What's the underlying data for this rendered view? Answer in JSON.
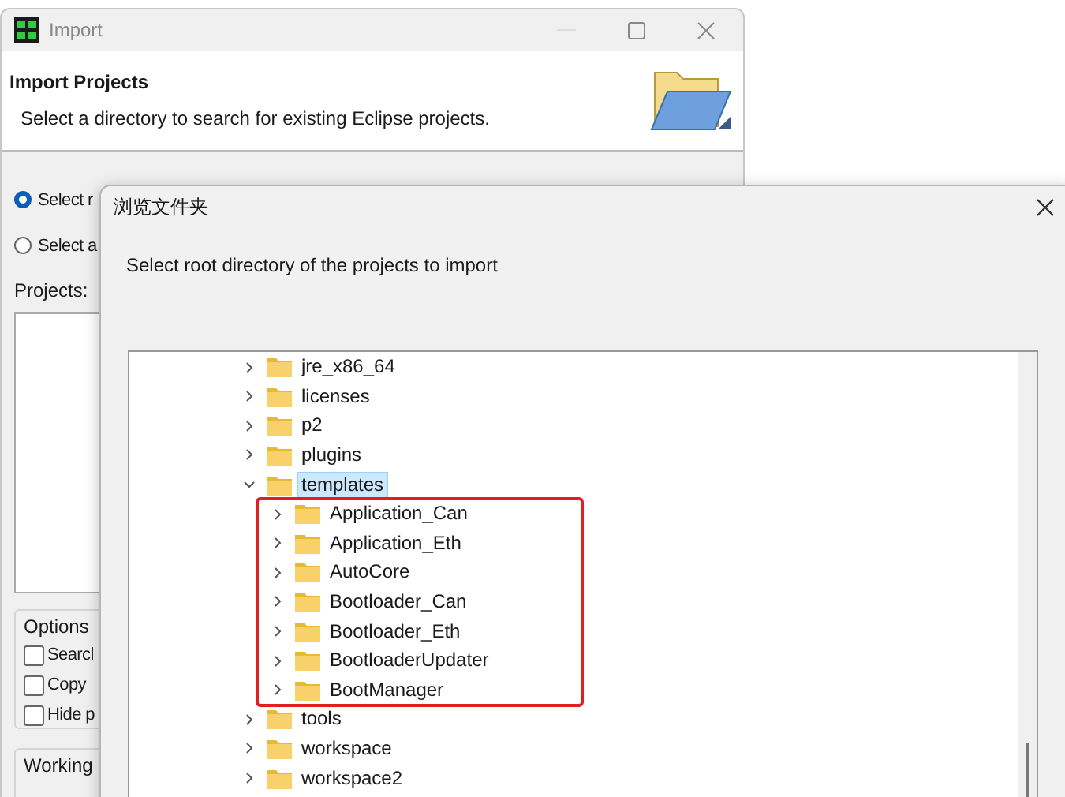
{
  "import_window": {
    "title": "Import",
    "header": {
      "title": "Import Projects",
      "description": "Select a directory to search for existing Eclipse projects."
    },
    "source_options": [
      {
        "label": "Select r",
        "selected": true
      },
      {
        "label": "Select a",
        "selected": false
      }
    ],
    "projects_label": "Projects:",
    "options_group": {
      "title": "Options",
      "checkboxes": [
        {
          "label": "Searcl",
          "checked": false
        },
        {
          "label": "Copy",
          "checked": false
        },
        {
          "label": "Hide p",
          "checked": false
        }
      ]
    },
    "working_group": {
      "title": "Working"
    }
  },
  "browse_dialog": {
    "title": "浏览文件夹",
    "prompt": "Select root directory of the projects to import",
    "tree": [
      {
        "name": "jre_x86_64",
        "expanded": false,
        "selected": false
      },
      {
        "name": "licenses",
        "expanded": false,
        "selected": false
      },
      {
        "name": "p2",
        "expanded": false,
        "selected": false
      },
      {
        "name": "plugins",
        "expanded": false,
        "selected": false
      },
      {
        "name": "templates",
        "expanded": true,
        "selected": true,
        "children": [
          {
            "name": "Application_Can",
            "expanded": false,
            "selected": false
          },
          {
            "name": "Application_Eth",
            "expanded": false,
            "selected": false
          },
          {
            "name": "AutoCore",
            "expanded": false,
            "selected": false
          },
          {
            "name": "Bootloader_Can",
            "expanded": false,
            "selected": false
          },
          {
            "name": "Bootloader_Eth",
            "expanded": false,
            "selected": false
          },
          {
            "name": "BootloaderUpdater",
            "expanded": false,
            "selected": false
          },
          {
            "name": "BootManager",
            "expanded": false,
            "selected": false
          }
        ]
      },
      {
        "name": "tools",
        "expanded": false,
        "selected": false
      },
      {
        "name": "workspace",
        "expanded": false,
        "selected": false
      },
      {
        "name": "workspace2",
        "expanded": false,
        "selected": false
      }
    ]
  }
}
